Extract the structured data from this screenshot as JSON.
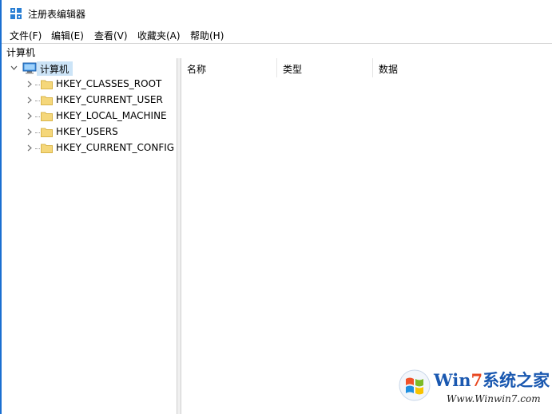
{
  "window": {
    "title": "注册表编辑器"
  },
  "menu": {
    "items": [
      "文件(F)",
      "编辑(E)",
      "查看(V)",
      "收藏夹(A)",
      "帮助(H)"
    ]
  },
  "address": {
    "path": "计算机"
  },
  "tree": {
    "root": {
      "label": "计算机",
      "icon": "computer-icon"
    },
    "hives": [
      {
        "label": "HKEY_CLASSES_ROOT",
        "icon": "folder-icon"
      },
      {
        "label": "HKEY_CURRENT_USER",
        "icon": "folder-icon"
      },
      {
        "label": "HKEY_LOCAL_MACHINE",
        "icon": "folder-icon"
      },
      {
        "label": "HKEY_USERS",
        "icon": "folder-icon"
      },
      {
        "label": "HKEY_CURRENT_CONFIG",
        "icon": "folder-icon"
      }
    ]
  },
  "list": {
    "columns": [
      "名称",
      "类型",
      "数据"
    ]
  },
  "watermark": {
    "brand_pre": "Win",
    "brand_seven": "7",
    "brand_post": "系统之家",
    "url": "Www.Winwin7.com"
  },
  "colors": {
    "selection": "#cce4f7",
    "folder": "#f5d77a",
    "accent": "#1a6fd1"
  }
}
